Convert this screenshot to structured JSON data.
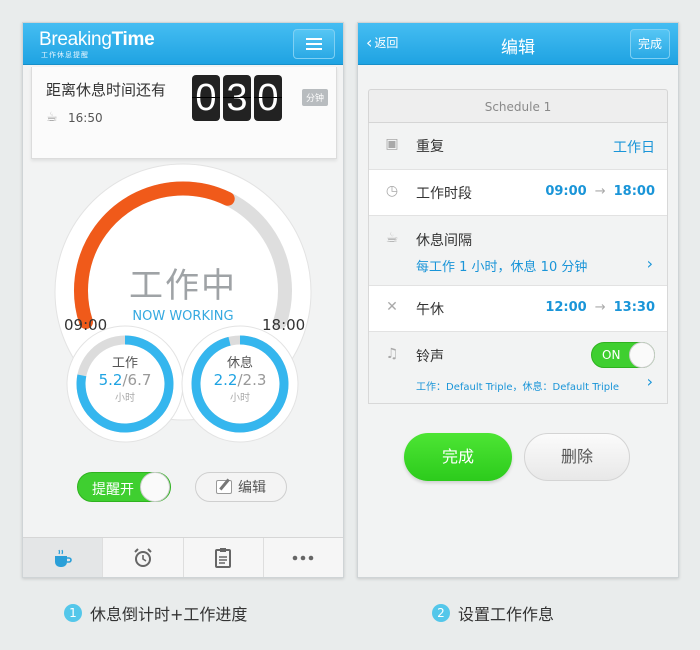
{
  "screen1": {
    "logo_light": "Breaking",
    "logo_bold": "Time",
    "logo_sub": "工作休息提醒",
    "countdown_label": "距离休息时间还有",
    "break_time": "16:50",
    "digits": [
      "0",
      "3",
      "0"
    ],
    "unit": "分钟",
    "status_cn": "工作中",
    "status_en": "NOW WORKING",
    "start_time": "09:00",
    "end_time": "18:00",
    "progress_fraction": 0.62,
    "work": {
      "label": "工作",
      "done": "5.2",
      "total": "/6.7",
      "unit": "小时",
      "fraction": 0.78
    },
    "rest": {
      "label": "休息",
      "done": "2.2",
      "total": "/2.3",
      "unit": "小时",
      "fraction": 0.96
    },
    "reminder_toggle": "提醒开",
    "edit_button": "编辑",
    "colors": {
      "accent": "#1fa3e2",
      "progress": "#f05a1a",
      "ring": "#35b6ee",
      "toggle_on": "#3fcf30"
    }
  },
  "screen2": {
    "back": "返回",
    "title": "编辑",
    "done": "完成",
    "schedule": "Schedule 1",
    "rows": {
      "repeat": {
        "label": "重复",
        "value": "工作日"
      },
      "work_period": {
        "label": "工作时段",
        "start": "09:00",
        "end": "18:00"
      },
      "interval": {
        "label": "休息间隔",
        "detail": "每工作 1 小时，休息 10 分钟"
      },
      "lunch": {
        "label": "午休",
        "start": "12:00",
        "end": "13:30"
      },
      "ringtone": {
        "label": "铃声",
        "toggle": "ON",
        "detail": "工作：Default Triple，休息：Default Triple"
      }
    },
    "done_button": "完成",
    "delete_button": "删除"
  },
  "captions": [
    {
      "num": "1",
      "text": "休息倒计时+工作进度"
    },
    {
      "num": "2",
      "text": "设置工作作息"
    }
  ]
}
